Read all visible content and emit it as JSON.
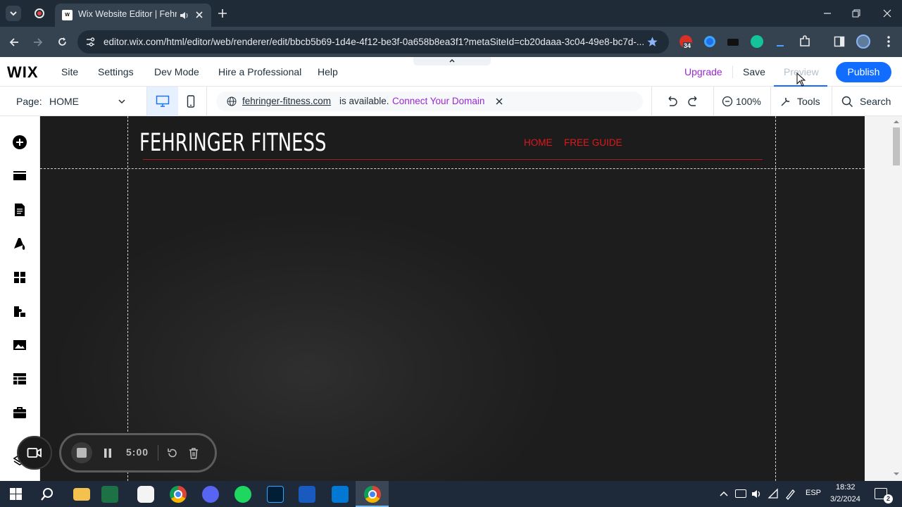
{
  "browser": {
    "tab_title": "Wix Website Editor | Fehringer",
    "url": "editor.wix.com/html/editor/web/renderer/edit/bbcb5b69-1d4e-4f12-be3f-0a658b8ea3f1?metaSiteId=cb20daaa-3c04-49e8-bc7d-...",
    "extension_badge": "34"
  },
  "wix": {
    "logo": "WIX",
    "menu": [
      "Site",
      "Settings",
      "Dev Mode",
      "Hire a Professional",
      "Help"
    ],
    "upgrade": "Upgrade",
    "save": "Save",
    "preview": "Preview",
    "publish": "Publish"
  },
  "secondbar": {
    "page_label": "Page:",
    "page_value": "HOME",
    "domain": "fehringer-fitness.com",
    "domain_status": "is available.",
    "connect": "Connect Your Domain",
    "zoom": "100%",
    "tools": "Tools",
    "search": "Search"
  },
  "site": {
    "title": "FEHRINGER FITNESS",
    "nav": [
      "HOME",
      "FREE GUIDE"
    ],
    "accent": "#e0181b"
  },
  "recorder": {
    "time": "5:00"
  },
  "taskbar": {
    "language": "ESP",
    "time": "18:32",
    "date": "3/2/2024",
    "notifications": "2"
  },
  "colors": {
    "wix_blue": "#116dff",
    "purple": "#9a27d5",
    "chrome_dark": "#202b38"
  }
}
